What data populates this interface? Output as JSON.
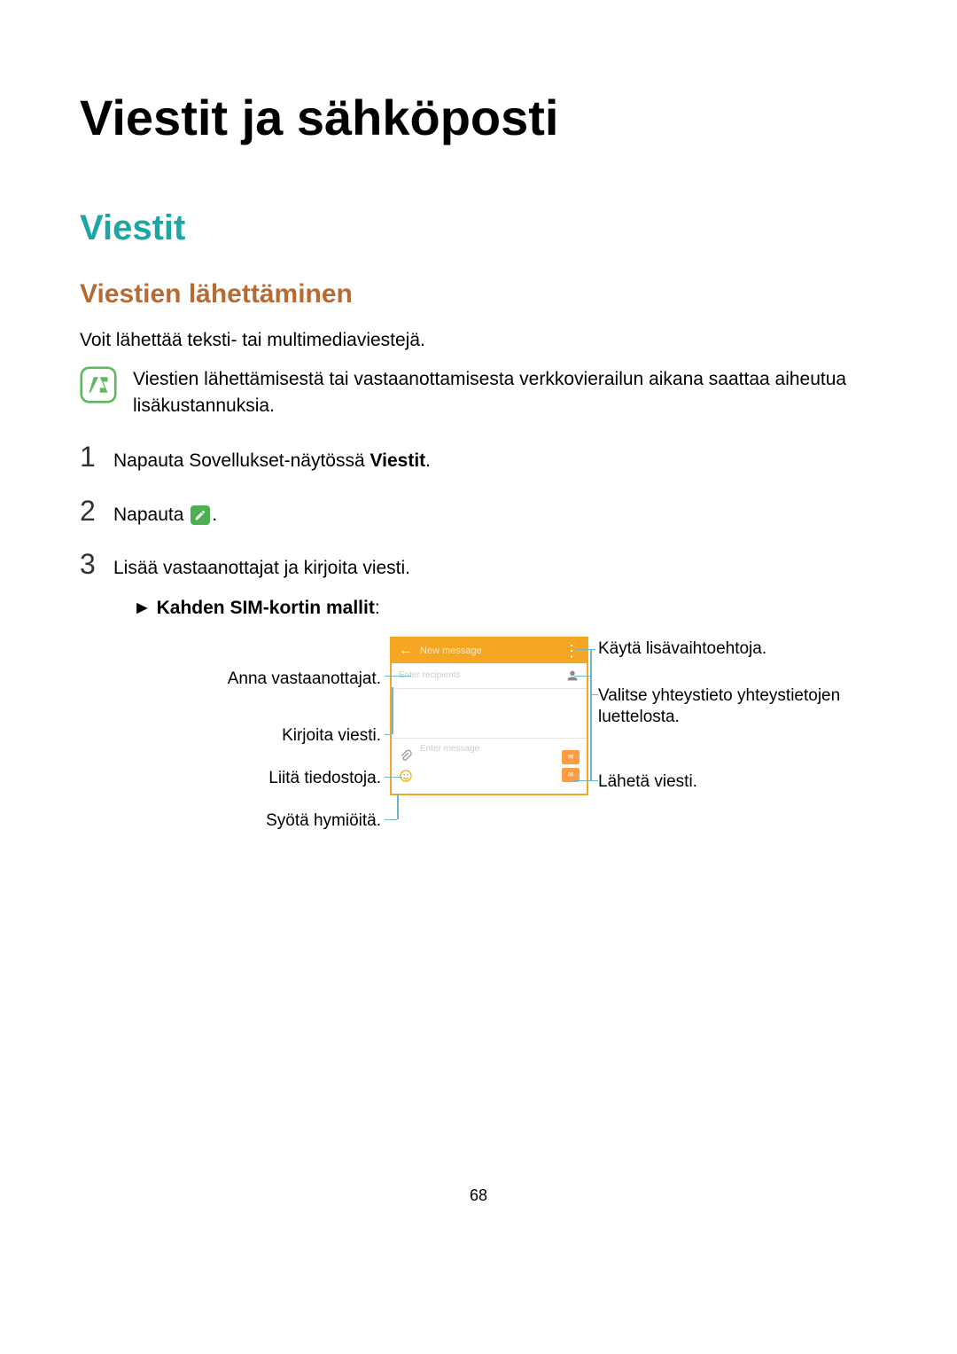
{
  "page_title": "Viestit ja sähköposti",
  "section_title": "Viestit",
  "subsection_title": "Viestien lähettäminen",
  "intro": "Voit lähettää teksti- tai multimediaviestejä.",
  "note": "Viestien lähettämisestä tai vastaanottamisesta verkkovierailun aikana saattaa aiheutua lisäkustannuksia.",
  "steps": {
    "s1_pre": "Napauta Sovellukset-näytössä ",
    "s1_bold": "Viestit",
    "s1_post": ".",
    "s2_pre": "Napauta ",
    "s2_post": ".",
    "s3": "Lisää vastaanottajat ja kirjoita viesti.",
    "s3_sub_arrow": "► ",
    "s3_sub_bold": "Kahden SIM-kortin mallit",
    "s3_sub_colon": ":"
  },
  "screenshot": {
    "header_title": "New message",
    "recipients_ph": "Enter recipients",
    "message_ph": "Enter message"
  },
  "callouts": {
    "more_options": "Käytä lisävaihtoehtoja.",
    "recipients": "Anna vastaanottajat.",
    "select_contact": "Valitse yhteystieto yhteystietojen luettelosta.",
    "write_message": "Kirjoita viesti.",
    "attach": "Liitä tiedostoja.",
    "emoji": "Syötä hymiöitä.",
    "send": "Lähetä viesti."
  },
  "page_number": "68"
}
